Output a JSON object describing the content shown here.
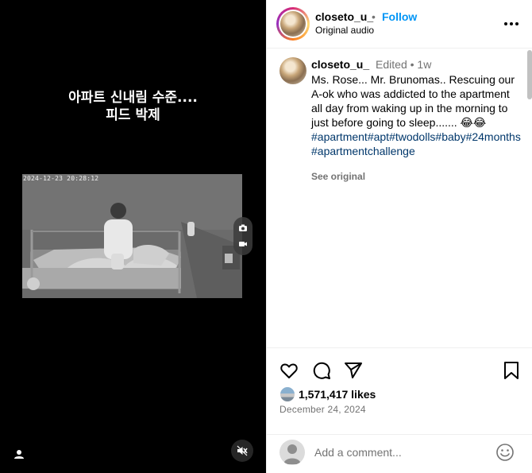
{
  "video": {
    "overlay_caption": "아파트 신내림 수준....\n피드 박제",
    "cam_timestamp": "2024-12-23 20:28:12",
    "icons": {
      "camera": "camera-icon",
      "record": "video-record-icon",
      "user": "user-tag-icon",
      "mute": "speaker-muted-icon"
    }
  },
  "header": {
    "username": "closeto_u_",
    "separator": "•",
    "follow_label": "Follow",
    "audio_label": "Original audio",
    "more_icon": "more-horizontal-icon"
  },
  "caption": {
    "username": "closeto_u_",
    "edited_label": "Edited",
    "separator": "•",
    "time": "1w",
    "text": "Ms. Rose... Mr. Brunomas.. Rescuing our A-ok who was addicted to the apartment all day from waking up in the morning to just before going to sleep....... 😂😂",
    "hashtags": "#apartment#apt#twodolls#baby#24months#apartmentchallenge",
    "see_original": "See original"
  },
  "actions": {
    "icons": [
      "heart-icon",
      "comment-icon",
      "share-icon",
      "bookmark-icon"
    ],
    "likes": "1,571,417 likes",
    "date": "December 24, 2024"
  },
  "comment": {
    "placeholder": "Add a comment...",
    "emoji_icon": "emoji-icon"
  },
  "colors": {
    "accent": "#0095f6",
    "hashtag": "#00376b",
    "muted": "#737373",
    "video_bg": "#000000"
  }
}
